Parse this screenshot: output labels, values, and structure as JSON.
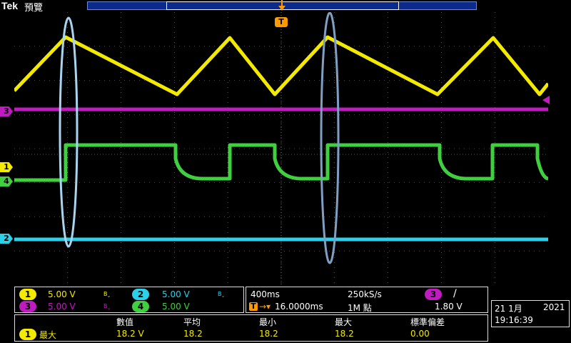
{
  "brand": "Tek",
  "mode": "預覽",
  "channels": [
    {
      "num": "1",
      "scale": "5.00 V",
      "bw": "Bˬ",
      "color": "#f3ea00"
    },
    {
      "num": "2",
      "scale": "5.00 V",
      "bw": "Bˬ",
      "color": "#2ad1e8"
    },
    {
      "num": "3",
      "scale": "5.00 V",
      "bw": "Bˬ",
      "color": "#c01bc0"
    },
    {
      "num": "4",
      "scale": "5.00 V",
      "bw": "Bˬ",
      "color": "#3fcf3f"
    }
  ],
  "timebase": {
    "time_div": "400ms",
    "sample_rate": "250kS/s",
    "trigger_source": "3",
    "trigger_slope": "/",
    "trigger_pos": "16.0000ms",
    "record_length": "1M 點",
    "trigger_level": "1.80 V"
  },
  "date": {
    "day_month": "21 1月",
    "year": "2021",
    "time": "19:16:39"
  },
  "measurements": {
    "headers": [
      "數值",
      "平均",
      "最小",
      "最大",
      "標準偏差"
    ],
    "rows": [
      {
        "channel": "1",
        "type": "最大",
        "values": [
          "18.2 V",
          "18.2",
          "18.2",
          "18.2",
          "0.00"
        ]
      }
    ]
  },
  "markers": {
    "trigger": "T",
    "ch1": "1",
    "ch2": "2",
    "ch3": "3",
    "ch4": "4"
  },
  "colors": {
    "ch1": "#f3ea00",
    "ch2": "#2ad1e8",
    "ch3": "#c01bc0",
    "ch4": "#3fcf3f",
    "trigger": "#ff9a00",
    "grid": "#8a8a8a",
    "highlight_ellipse": "#a9d4f0"
  }
}
